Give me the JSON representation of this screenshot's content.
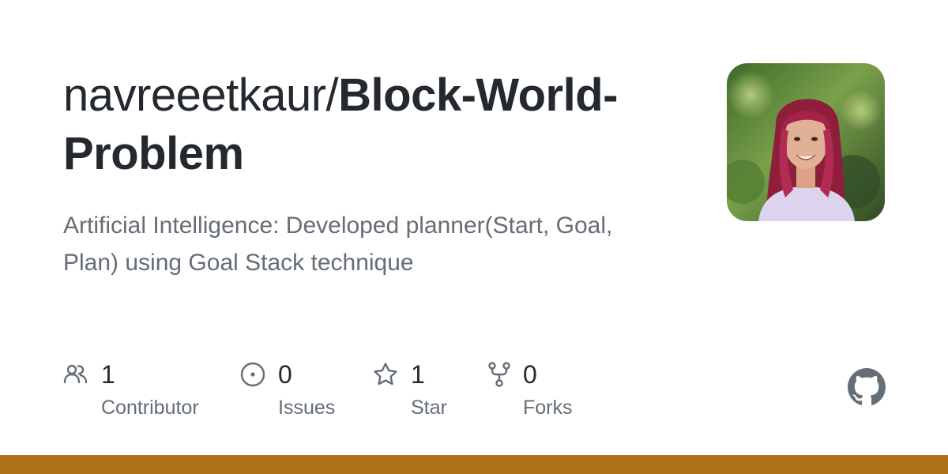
{
  "repo": {
    "owner": "navreeetkaur/",
    "name": "Block-World-Problem",
    "description": "Artificial Intelligence: Developed planner(Start, Goal, Plan) using Goal Stack technique"
  },
  "avatar": {
    "icon": "user-avatar-photo"
  },
  "stats": {
    "contributors": {
      "count": "1",
      "label": "Contributor",
      "icon": "people-icon"
    },
    "issues": {
      "count": "0",
      "label": "Issues",
      "icon": "issue-opened-icon"
    },
    "stars": {
      "count": "1",
      "label": "Star",
      "icon": "star-icon"
    },
    "forks": {
      "count": "0",
      "label": "Forks",
      "icon": "repo-forked-icon"
    }
  },
  "branding": {
    "logo_icon": "github-mark-icon",
    "accent_color": "#b07219"
  },
  "colors": {
    "title": "#24292f",
    "muted": "#656d76",
    "icon": "#656d76"
  }
}
